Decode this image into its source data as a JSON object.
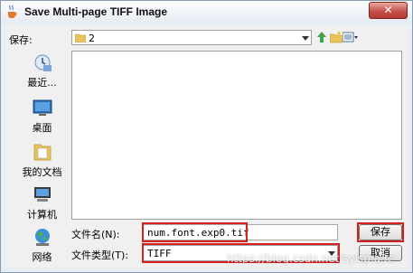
{
  "window": {
    "title": "Save Multi-page TIFF Image",
    "close_label": "✕"
  },
  "save_in": {
    "label": "保存:",
    "folder": "2"
  },
  "places": [
    {
      "label": "最近..."
    },
    {
      "label": "桌面"
    },
    {
      "label": "我的文档"
    },
    {
      "label": "计算机"
    },
    {
      "label": "网络"
    }
  ],
  "filename": {
    "label": "文件名(N):",
    "value": "num.font.exp0.tif"
  },
  "filetype": {
    "label": "文件类型(T):",
    "value": "TIFF"
  },
  "buttons": {
    "save": "保存",
    "cancel": "取消"
  },
  "watermark": "https://blog.csdn.net/sylsp.a3e",
  "colors": {
    "highlight": "#d61f1f",
    "title_bg": "#e6ebf2"
  }
}
